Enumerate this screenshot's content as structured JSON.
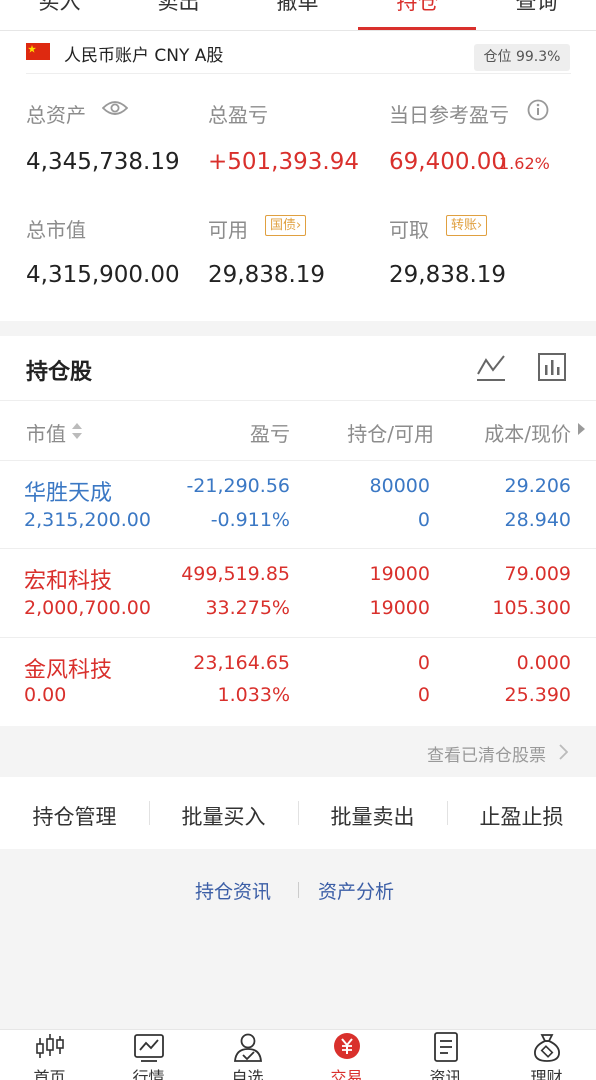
{
  "top_tabs": [
    {
      "label": "买入"
    },
    {
      "label": "卖出"
    },
    {
      "label": "撤单"
    },
    {
      "label": "持仓"
    },
    {
      "label": "查询"
    }
  ],
  "account": {
    "name": "人民币账户 CNY A股",
    "position_badge": "仓位 99.3%",
    "total_assets_label": "总资产",
    "total_assets": "4,345,738.19",
    "total_pnl_label": "总盈亏",
    "total_pnl": "+501,393.94",
    "daily_pnl_label": "当日参考盈亏",
    "daily_pnl": "69,400.00",
    "daily_pnl_pct": "1.62%",
    "market_value_label": "总市值",
    "market_value": "4,315,900.00",
    "available_label": "可用",
    "available_tag": "国债",
    "available": "29,838.19",
    "withdrawable_label": "可取",
    "withdrawable_tag": "转账",
    "withdrawable": "29,838.19"
  },
  "holdings": {
    "title": "持仓股",
    "headers": {
      "market_value": "市值",
      "pnl": "盈亏",
      "position": "持仓/可用",
      "cost": "成本/现价"
    },
    "rows": [
      {
        "name": "华胜天成",
        "market_value": "2,315,200.00",
        "pnl": "-21,290.56",
        "pnl_pct": "-0.911%",
        "position": "80000",
        "available": "0",
        "cost": "29.206",
        "price": "28.940"
      },
      {
        "name": "宏和科技",
        "market_value": "2,000,700.00",
        "pnl": "499,519.85",
        "pnl_pct": "33.275%",
        "position": "19000",
        "available": "19000",
        "cost": "79.009",
        "price": "105.300"
      },
      {
        "name": "金风科技",
        "market_value": "0.00",
        "pnl": "23,164.65",
        "pnl_pct": "1.033%",
        "position": "0",
        "available": "0",
        "cost": "0.000",
        "price": "25.390"
      }
    ]
  },
  "cleared_link": "查看已清仓股票",
  "actions": [
    {
      "label": "持仓管理"
    },
    {
      "label": "批量买入"
    },
    {
      "label": "批量卖出"
    },
    {
      "label": "止盈止损"
    }
  ],
  "links": {
    "news": "持仓资讯",
    "analysis": "资产分析"
  },
  "bottom_nav": [
    {
      "label": "首页",
      "icon": "candlestick-icon"
    },
    {
      "label": "行情",
      "icon": "chart-icon"
    },
    {
      "label": "自选",
      "icon": "user-check-icon"
    },
    {
      "label": "交易",
      "icon": "yuan-icon"
    },
    {
      "label": "资讯",
      "icon": "document-icon"
    },
    {
      "label": "理财",
      "icon": "money-bag-icon"
    }
  ],
  "colors": {
    "accent": "#d9302c",
    "loss": "#3b78c4",
    "tag": "#e0a040"
  }
}
